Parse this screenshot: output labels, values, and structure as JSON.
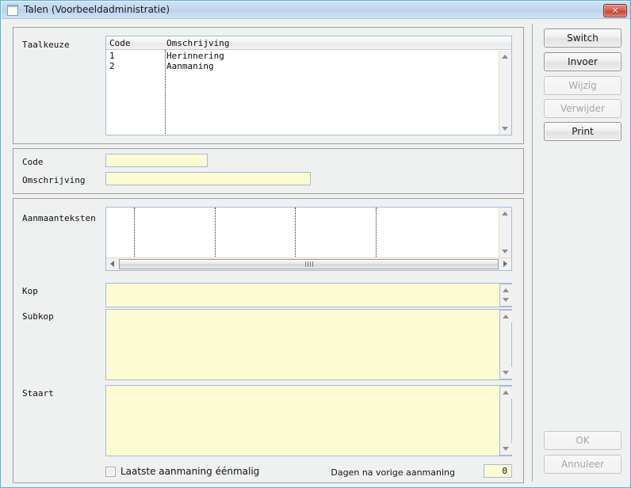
{
  "window": {
    "title": "Talen (Voorbeeldadministratie)",
    "icon": "window-icon",
    "close_label": "✕",
    "frame_color": "#4ab8e0"
  },
  "taalkeuze": {
    "label": "Taalkeuze",
    "columns": [
      "Code",
      "Omschrijving"
    ],
    "rows": [
      {
        "code": "1",
        "omschrijving": "Herinnering"
      },
      {
        "code": "2",
        "omschrijving": "Aanmaning"
      }
    ]
  },
  "detail": {
    "code_label": "Code",
    "code_value": "",
    "omschrijving_label": "Omschrijving",
    "omschrijving_value": ""
  },
  "teksten": {
    "aanmaanteksten_label": "Aanmaanteksten",
    "kop_label": "Kop",
    "kop_value": "",
    "subkop_label": "Subkop",
    "subkop_value": "",
    "staart_label": "Staart",
    "staart_value": "",
    "laatste_checkbox_label": "Laatste aanmaning éénmalig",
    "laatste_checkbox_checked": false,
    "dagen_label": "Dagen na vorige aanmaning",
    "dagen_value": "0"
  },
  "buttons": {
    "switch": {
      "label": "Switch",
      "enabled": true
    },
    "invoer": {
      "label": "Invoer",
      "enabled": true
    },
    "wijzig": {
      "label": "Wijzig",
      "enabled": false
    },
    "verwijder": {
      "label": "Verwijder",
      "enabled": false
    },
    "print": {
      "label": "Print",
      "enabled": true
    },
    "ok": {
      "label": "OK",
      "enabled": false
    },
    "annuleer": {
      "label": "Annuleer",
      "enabled": false
    }
  },
  "colors": {
    "input_yellow": "#fdfbd2",
    "input_border": "#a4bcd6",
    "window_bg": "#eff0f0",
    "titlebar": "#c3d8ee",
    "close_red": "#c7432f"
  }
}
